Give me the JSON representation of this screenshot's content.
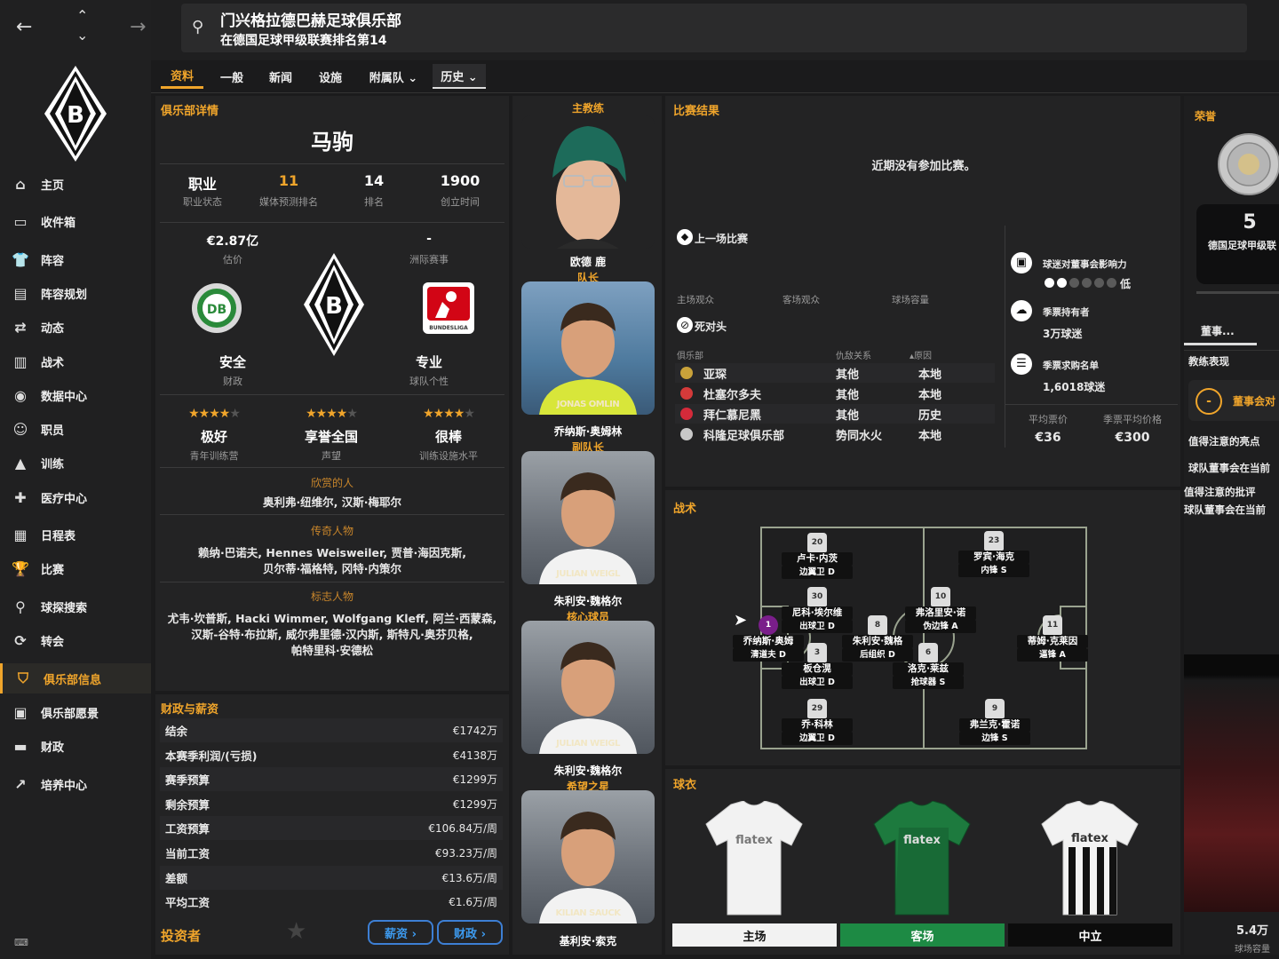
{
  "nav": {
    "back": "←",
    "up": "⌃",
    "down": "⌄",
    "forward": "→"
  },
  "header": {
    "title": "门兴格拉德巴赫足球俱乐部",
    "subtitle": "在德国足球甲级联赛排名第14"
  },
  "tabs": [
    {
      "label": "资料"
    },
    {
      "label": "一般"
    },
    {
      "label": "新闻"
    },
    {
      "label": "设施"
    },
    {
      "label": "附属队 ⌄"
    },
    {
      "label": "历史 ⌄"
    }
  ],
  "sidebar": {
    "items": [
      {
        "label": "主页",
        "icon": "home-icon"
      },
      {
        "label": "收件箱",
        "icon": "inbox-icon"
      },
      {
        "label": "阵容",
        "icon": "shirt-icon"
      },
      {
        "label": "阵容规划",
        "icon": "clipboard-icon"
      },
      {
        "label": "动态",
        "icon": "dynamics-icon"
      },
      {
        "label": "战术",
        "icon": "tactics-icon"
      },
      {
        "label": "数据中心",
        "icon": "data-icon"
      },
      {
        "label": "职员",
        "icon": "staff-icon"
      },
      {
        "label": "训练",
        "icon": "training-icon"
      },
      {
        "label": "医疗中心",
        "icon": "medical-icon"
      },
      {
        "label": "日程表",
        "icon": "calendar-icon"
      },
      {
        "label": "比赛",
        "icon": "trophy-icon"
      },
      {
        "label": "球探搜索",
        "icon": "search-icon"
      },
      {
        "label": "转会",
        "icon": "transfer-icon"
      },
      {
        "label": "俱乐部信息",
        "icon": "shield-icon"
      },
      {
        "label": "俱乐部愿景",
        "icon": "vision-icon"
      },
      {
        "label": "财政",
        "icon": "finance-icon"
      },
      {
        "label": "培养中心",
        "icon": "development-icon"
      }
    ]
  },
  "club": {
    "section_title": "俱乐部详情",
    "nickname": "马驹",
    "stats": [
      {
        "value": "职业",
        "label": "职业状态"
      },
      {
        "value": "11",
        "label": "媒体预测排名"
      },
      {
        "value": "14",
        "label": "排名"
      },
      {
        "value": "1900",
        "label": "创立时间"
      }
    ],
    "value": {
      "value": "€2.87亿",
      "label": "估价"
    },
    "continental": {
      "value": "-",
      "label": "洲际赛事"
    },
    "finance_status": {
      "value": "安全",
      "label": "财政"
    },
    "personality": {
      "value": "专业",
      "label": "球队个性"
    },
    "ratings": [
      {
        "value": "极好",
        "label": "青年训练营",
        "stars": 3.5
      },
      {
        "value": "享誉全国",
        "label": "声望",
        "stars": 3.5
      },
      {
        "value": "很棒",
        "label": "训练设施水平",
        "stars": 3.5
      }
    ],
    "admired": {
      "title": "欣赏的人",
      "text": "奥利弗·纽维尔, 汉斯·梅耶尔"
    },
    "legends": {
      "title": "传奇人物",
      "line1": "赖纳·巴诺夫, Hennes Weisweiler, 贾普·海因克斯,",
      "line2": "贝尔蒂·福格特, 冈特·内策尔"
    },
    "icons": {
      "title": "标志人物",
      "line1": "尤韦·坎普斯, Hacki Wimmer, Wolfgang Kleff, 阿兰·西蒙森,",
      "line2": "汉斯-谷特·布拉斯, 威尔弗里德·汉内斯, 斯特凡·奥芬贝格,",
      "line3": "帕特里科·安德松"
    }
  },
  "finance": {
    "title": "财政与薪资",
    "rows": [
      {
        "label": "结余",
        "value": "€1742万"
      },
      {
        "label": "本赛季利润/(亏损)",
        "value": "€4138万"
      },
      {
        "label": "赛季预算",
        "value": "€1299万"
      },
      {
        "label": "剩余预算",
        "value": "€1299万"
      },
      {
        "label": "工资预算",
        "value": "€106.84万/周"
      },
      {
        "label": "当前工资",
        "value": "€93.23万/周"
      },
      {
        "label": "差额",
        "value": "€13.6万/周"
      },
      {
        "label": "平均工资",
        "value": "€1.6万/周"
      }
    ],
    "investors": "投资者",
    "salary_btn": "薪资 ›",
    "finance_btn": "财政 ›"
  },
  "staff": [
    {
      "role": "主教练",
      "name": "欧德 鹿",
      "photo_text": ""
    },
    {
      "role": "队长",
      "name": "乔纳斯·奥姆林",
      "photo_text": "JONAS OMLIN"
    },
    {
      "role": "副队长",
      "name": "朱利安·魏格尔",
      "photo_text": "JULIAN WEIGL"
    },
    {
      "role": "核心球员",
      "name": "朱利安·魏格尔",
      "photo_text": "JULIAN WEIGL"
    },
    {
      "role": "希望之星",
      "name": "基利安·索克",
      "photo_text": "KILIAN SAUCK"
    }
  ],
  "results": {
    "title": "比赛结果",
    "empty": "近期没有参加比赛。"
  },
  "last_match": "上一场比赛",
  "attendance": {
    "home": "主场观众",
    "away": "客场观众",
    "capacity": "球场容量"
  },
  "rivals": {
    "title": "死对头",
    "headers": [
      "俱乐部",
      "仇敌关系",
      "▴原因"
    ],
    "rows": [
      {
        "club": "亚琛",
        "relation": "其他",
        "reason": "本地"
      },
      {
        "club": "杜塞尔多夫",
        "relation": "其他",
        "reason": "本地"
      },
      {
        "club": "拜仁慕尼黑",
        "relation": "其他",
        "reason": "历史"
      },
      {
        "club": "科隆足球俱乐部",
        "relation": "势同水火",
        "reason": "本地"
      }
    ]
  },
  "fans": {
    "influence_label": "球迷对董事会影响力",
    "influence_value": "低",
    "influence_level": 2,
    "season_holders_label": "季票持有者",
    "season_holders_value": "3万球迷",
    "waitlist_label": "季票求购名单",
    "waitlist_value": "1,6018球迷",
    "avg_ticket_label": "平均票价",
    "avg_ticket_value": "€36",
    "season_price_label": "季票平均价格",
    "season_price_value": "€300"
  },
  "tactics": {
    "title": "战术",
    "players": [
      {
        "num": "20",
        "name": "卢卡·内茨",
        "pos": "边翼卫 D"
      },
      {
        "num": "23",
        "name": "罗宾·海克",
        "pos": "内锋 S"
      },
      {
        "num": "30",
        "name": "尼科·埃尔维",
        "pos": "出球卫 D"
      },
      {
        "num": "10",
        "name": "弗洛里安·诺",
        "pos": "伪边锋 A"
      },
      {
        "num": "1",
        "name": "乔纳斯·奥姆",
        "pos": "清道夫 D"
      },
      {
        "num": "8",
        "name": "朱利安·魏格",
        "pos": "后组织 D"
      },
      {
        "num": "6",
        "name": "洛克·莱兹",
        "pos": "抢球器 S"
      },
      {
        "num": "11",
        "name": "蒂姆·克莱因",
        "pos": "逼锋 A"
      },
      {
        "num": "3",
        "name": "板仓滉",
        "pos": "出球卫 D"
      },
      {
        "num": "29",
        "name": "乔·科林",
        "pos": "边翼卫 D"
      },
      {
        "num": "9",
        "name": "弗兰克·霍诺",
        "pos": "边锋 S"
      }
    ]
  },
  "kits": {
    "title": "球衣",
    "home": "主场",
    "away": "客场",
    "third": "中立",
    "sponsor": "flatex"
  },
  "honours": {
    "title": "荣誉",
    "count": "5",
    "label": "德国足球甲级联"
  },
  "board": {
    "tab1": "董事...",
    "tab2": "",
    "perf_label": "教练表现",
    "board_btn": "董事会对",
    "highlight_title": "值得注意的亮点",
    "highlight_text": "球队董事会在当前",
    "critic_title": "值得注意的批评",
    "critic_text": "球队董事会在当前"
  },
  "stadium": {
    "capacity_value": "5.4万",
    "capacity_label": "球场容量"
  }
}
